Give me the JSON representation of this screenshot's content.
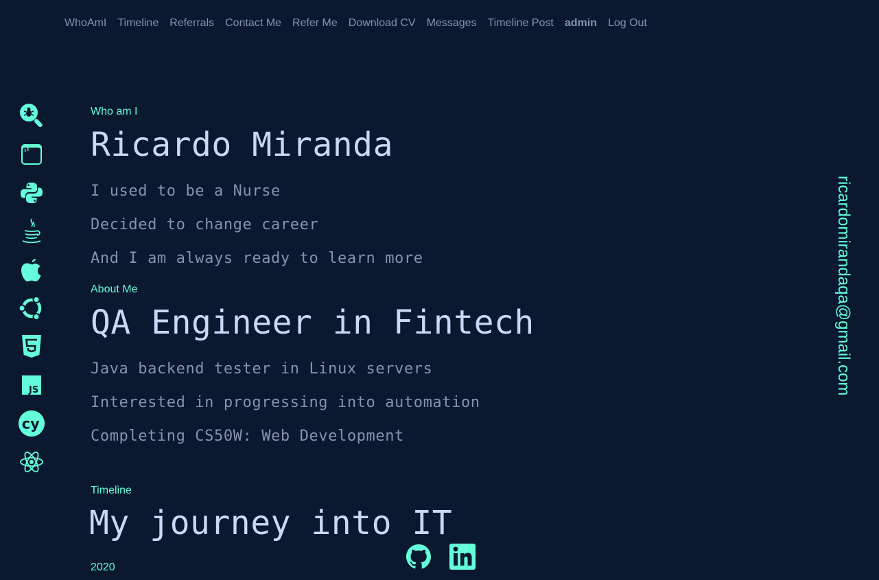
{
  "nav": {
    "items": [
      {
        "label": "WhoAmI",
        "bold": false
      },
      {
        "label": "Timeline",
        "bold": false
      },
      {
        "label": "Referrals",
        "bold": false
      },
      {
        "label": "Contact Me",
        "bold": false
      },
      {
        "label": "Refer Me",
        "bold": false
      },
      {
        "label": "Download CV",
        "bold": false
      },
      {
        "label": "Messages",
        "bold": false
      },
      {
        "label": "Timeline Post",
        "bold": false
      },
      {
        "label": "admin",
        "bold": true
      },
      {
        "label": "Log Out",
        "bold": false
      }
    ]
  },
  "sidebar": {
    "icons": [
      "qa-search-bug-icon",
      "terminal-icon",
      "python-icon",
      "java-icon",
      "apple-icon",
      "ubuntu-icon",
      "html5-icon",
      "javascript-icon",
      "cypress-icon",
      "react-icon"
    ],
    "accent": "#64ffda"
  },
  "whoami": {
    "eyebrow": "Who am I",
    "title": "Ricardo Miranda",
    "lines": [
      "I used to be a Nurse",
      "Decided to change career",
      "And I am always ready to learn more"
    ]
  },
  "about": {
    "eyebrow": "About Me",
    "title": "QA Engineer in Fintech",
    "lines": [
      "Java backend tester in Linux servers",
      "Interested in progressing into automation",
      "Completing CS50W: Web Development"
    ]
  },
  "timeline": {
    "eyebrow": "Timeline",
    "title": "My journey into IT",
    "year": "2020"
  },
  "contact": {
    "email": "ricardomirandaqa@gmail.com"
  },
  "social": {
    "icons": [
      "github-icon",
      "linkedin-icon"
    ]
  },
  "colors": {
    "background": "#0a192f",
    "accent": "#64ffda",
    "heading": "#ccd6f6",
    "text": "#8892b0"
  }
}
